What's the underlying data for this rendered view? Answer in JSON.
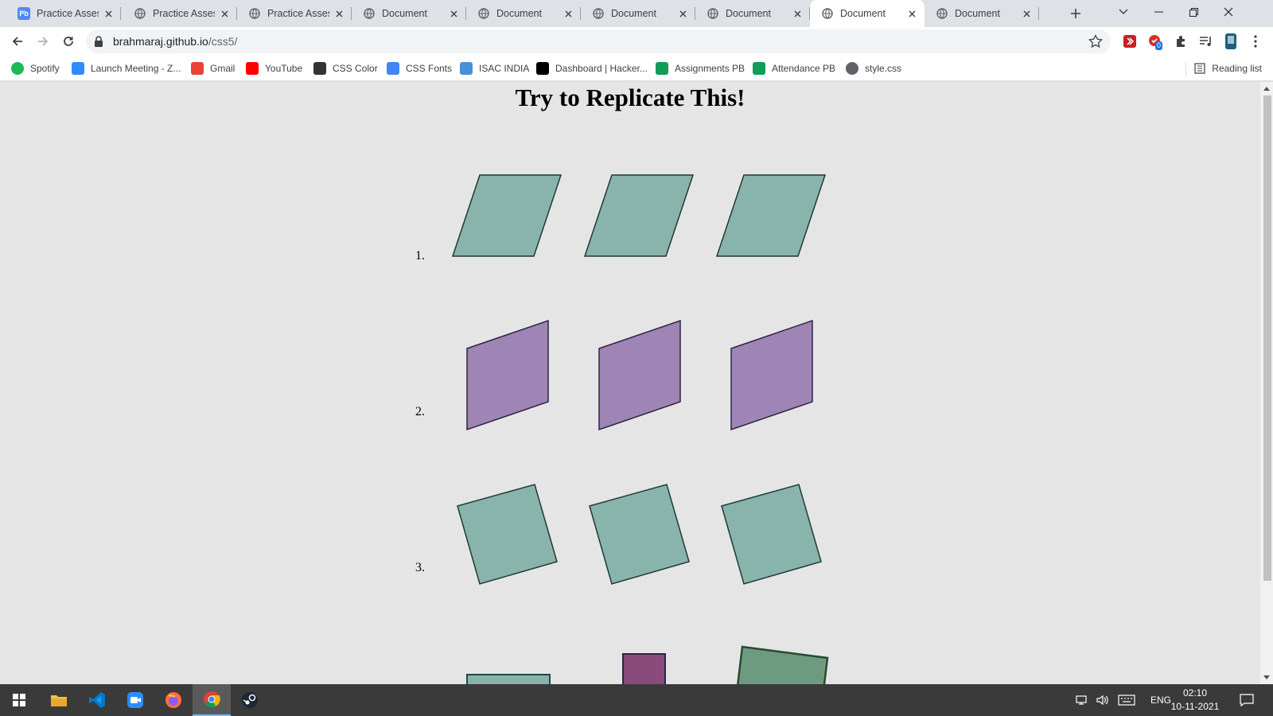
{
  "browser": {
    "tabs": [
      {
        "title": "Practice Assessm",
        "favicon": "pb-icon"
      },
      {
        "title": "Practice Assessm",
        "favicon": "globe-icon"
      },
      {
        "title": "Practice Assessm",
        "favicon": "globe-icon"
      },
      {
        "title": "Document",
        "favicon": "globe-icon"
      },
      {
        "title": "Document",
        "favicon": "globe-icon"
      },
      {
        "title": "Document",
        "favicon": "globe-icon"
      },
      {
        "title": "Document",
        "favicon": "globe-icon"
      },
      {
        "title": "Document",
        "favicon": "globe-icon",
        "active": true
      },
      {
        "title": "Document",
        "favicon": "globe-icon"
      }
    ],
    "pb_favicon_text": "Pb",
    "address": {
      "host": "brahmaraj.github.io",
      "path": "/css5/"
    },
    "extension_badge": "0",
    "bookmarks": [
      {
        "label": "Spotify",
        "icon": "spotify-icon",
        "color": "#1db954"
      },
      {
        "label": "Launch Meeting - Z...",
        "icon": "zoom-icon",
        "color": "#2d8cff"
      },
      {
        "label": "Gmail",
        "icon": "gmail-icon",
        "color": "#ea4335"
      },
      {
        "label": "YouTube",
        "icon": "youtube-icon",
        "color": "#ff0000"
      },
      {
        "label": "CSS Color",
        "icon": "css-color-icon",
        "color": "#333333"
      },
      {
        "label": "CSS Fonts",
        "icon": "css-fonts-icon",
        "color": "#4285f4"
      },
      {
        "label": "ISAC INDIA",
        "icon": "isac-icon",
        "color": "#4a90d9"
      },
      {
        "label": "Dashboard | Hacker...",
        "icon": "hackerrank-icon",
        "color": "#000000"
      },
      {
        "label": "Assignments PB",
        "icon": "sheets-icon",
        "color": "#0f9d58"
      },
      {
        "label": "Attendance PB",
        "icon": "sheets-icon",
        "color": "#0f9d58"
      },
      {
        "label": "style.css",
        "icon": "globe-icon",
        "color": "#5f6368"
      }
    ],
    "reading_list": "Reading list"
  },
  "page": {
    "title": "Try to Replicate This!",
    "rows": [
      {
        "number": "1.",
        "color": "#89b4ac"
      },
      {
        "number": "2.",
        "color": "#9f84b6"
      },
      {
        "number": "3.",
        "color": "#89b4ac"
      }
    ],
    "row4_colors": [
      "#89b4ac",
      "#8a4a7a",
      "#6e9a82"
    ]
  },
  "taskbar": {
    "apps": [
      "windows-start-icon",
      "file-explorer-icon",
      "vscode-icon",
      "zoom-icon",
      "firefox-icon",
      "chrome-icon",
      "steam-icon"
    ],
    "language": "ENG",
    "time": "02:10",
    "date": "10-11-2021"
  }
}
